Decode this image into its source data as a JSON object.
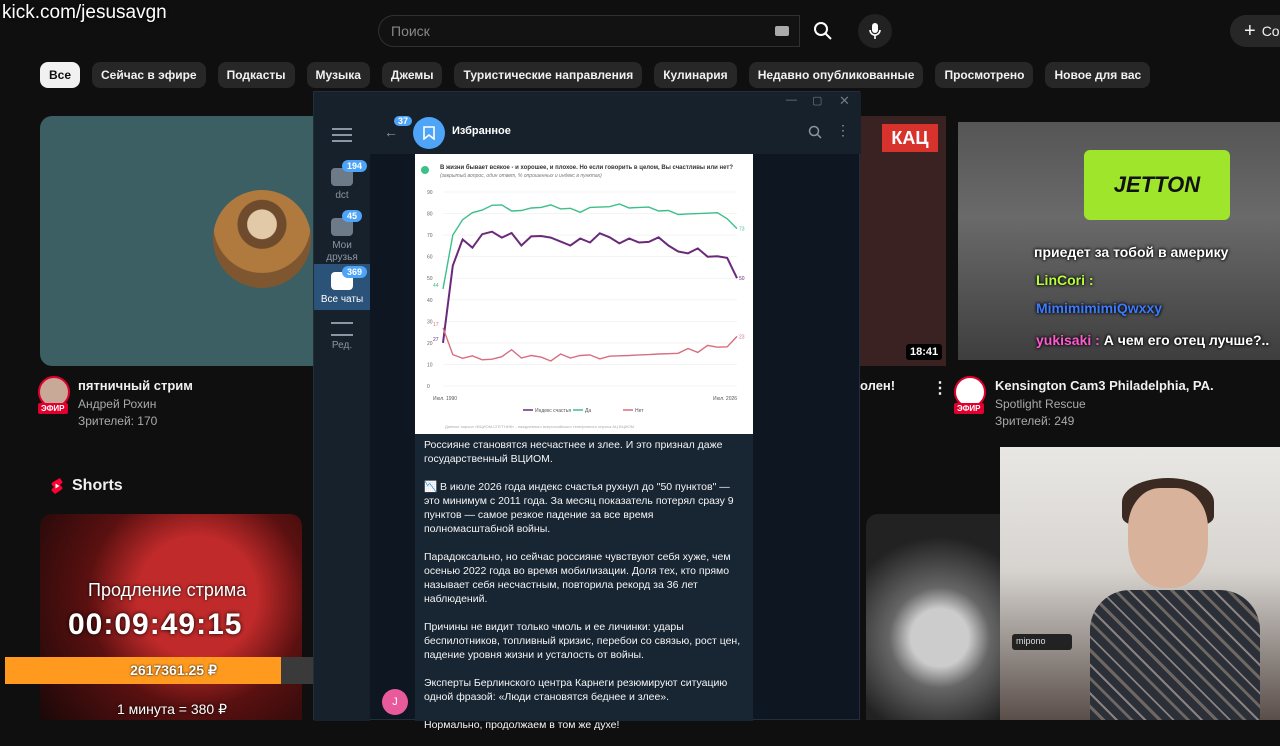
{
  "stream": {
    "url": "kick.com/jesusavgn",
    "extension_label": "Продление стрима",
    "timer": "00:09:49:15",
    "donation_total": "2617361.25 ₽",
    "donation_progress": 0.82,
    "rate": "1 минута = 380 ₽"
  },
  "youtube": {
    "search_placeholder": "Поиск",
    "create_label": "Со",
    "chips": [
      "Все",
      "Сейчас в эфире",
      "Подкасты",
      "Музыка",
      "Джемы",
      "Туристические направления",
      "Кулинария",
      "Недавно опубликованные",
      "Просмотрено",
      "Новое для вас"
    ],
    "video1": {
      "title": "пятничный стрим",
      "channel": "Андрей Рохин",
      "viewers": "Зрителей: 170",
      "live": "ЭФИР"
    },
    "video_mid": {
      "badge": "КАЦ",
      "duration": "18:41",
      "title_fragment": "олен!"
    },
    "video3": {
      "title": "Kensington Cam3  Philadelphia, PA.",
      "channel": "Spotlight Rescue",
      "viewers": "Зрителей: 249",
      "live": "ЭФИР",
      "ad_text": "JETTON"
    },
    "shorts_label": "Shorts"
  },
  "overlay_chat": [
    {
      "user": "",
      "text": "приедет за тобой в америку",
      "color": "#ffffff"
    },
    {
      "user": "LinCori :",
      "text": "",
      "color": "#b6ff3b"
    },
    {
      "user": "MimimimimiQwxxy",
      "text": "",
      "color": "#3b7bff"
    },
    {
      "user": "yukisaki :",
      "text": "А чем его отец лучше?..",
      "color": "#ff5ad1"
    }
  ],
  "webcam": {
    "mic_label": "mipono"
  },
  "telegram": {
    "back_count": "37",
    "chat_title": "Избранное",
    "folders": [
      {
        "label": "dct",
        "badge": "194"
      },
      {
        "label": "Мои друзья",
        "badge": "45"
      },
      {
        "label": "Все чаты",
        "badge": "369"
      },
      {
        "label": "Ред.",
        "badge": ""
      }
    ],
    "sender_initial": "J",
    "paragraphs": [
      "Россияне становятся несчастнее и злее. И это признал даже государственный ВЦИОМ.",
      "📉 В июле 2026 года индекс счастья рухнул до \"50 пунктов\" — это минимум с 2011 года. За месяц показатель потерял сразу 9 пунктов — самое резкое падение за все время полномасштабной войны.",
      "Парадоксально, но сейчас россияне чувствуют себя хуже, чем осенью 2022 года во время мобилизации. Доля тех, кто прямо называет себя несчастным, повторила рекорд за 36 лет наблюдений.",
      "Причины не видит только чмоль и ее личинки: удары беспилотников, топливный кризис, перебои со связью, рост цен, падение уровня жизни и усталость от войны.",
      "Эксперты Берлинского центра Карнеги резюмируют ситуацию одной фразой: «Люди становятся беднее и злее».",
      "Нормально, продолжаем в том же духе!"
    ]
  },
  "chart_data": {
    "type": "line",
    "title": "В жизни бывает всякое - и хорошее, и плохое. Но если говорить в целом, Вы счастливы или нет?",
    "subtitle": "(закрытый вопрос, один ответ, % опрошенных и индекс в пунктах)",
    "ylim": [
      0,
      90
    ],
    "yticks": [
      0,
      10,
      20,
      30,
      40,
      50,
      60,
      70,
      80,
      90
    ],
    "x_start_label": "Июл. 1990",
    "x_end_label": "Июл. 2026",
    "source": "Данные опроса «ВЦИОМ-СПУТНИК» - ежедневного всероссийского телефонного опроса АЦ ВЦИОМ",
    "series": [
      {
        "name": "Да",
        "color": "#3dbf8a",
        "values": [
          45,
          70,
          78,
          80,
          82,
          83,
          84,
          82,
          81,
          83,
          82,
          84,
          83,
          82,
          81,
          82,
          83,
          84,
          84,
          83,
          82,
          83,
          82,
          81,
          80,
          79,
          80,
          81,
          80,
          78,
          73
        ]
      },
      {
        "name": "Индекс счастья",
        "color": "#6a2a7a",
        "values": [
          20,
          55,
          68,
          65,
          70,
          72,
          68,
          71,
          66,
          69,
          70,
          68,
          67,
          66,
          68,
          67,
          70,
          69,
          67,
          68,
          67,
          66,
          69,
          66,
          62,
          62,
          63,
          60,
          61,
          59,
          50
        ]
      },
      {
        "name": "Нет",
        "color": "#d86d7e",
        "values": [
          27,
          15,
          12,
          14,
          13,
          12,
          14,
          16,
          13,
          15,
          13,
          12,
          14,
          13,
          15,
          14,
          13,
          13,
          14,
          15,
          14,
          15,
          14,
          15,
          16,
          17,
          16,
          18,
          18,
          19,
          23
        ]
      }
    ],
    "end_labels": [
      "73",
      "50",
      "23"
    ],
    "start_labels": [
      "44",
      "27",
      "17"
    ]
  }
}
